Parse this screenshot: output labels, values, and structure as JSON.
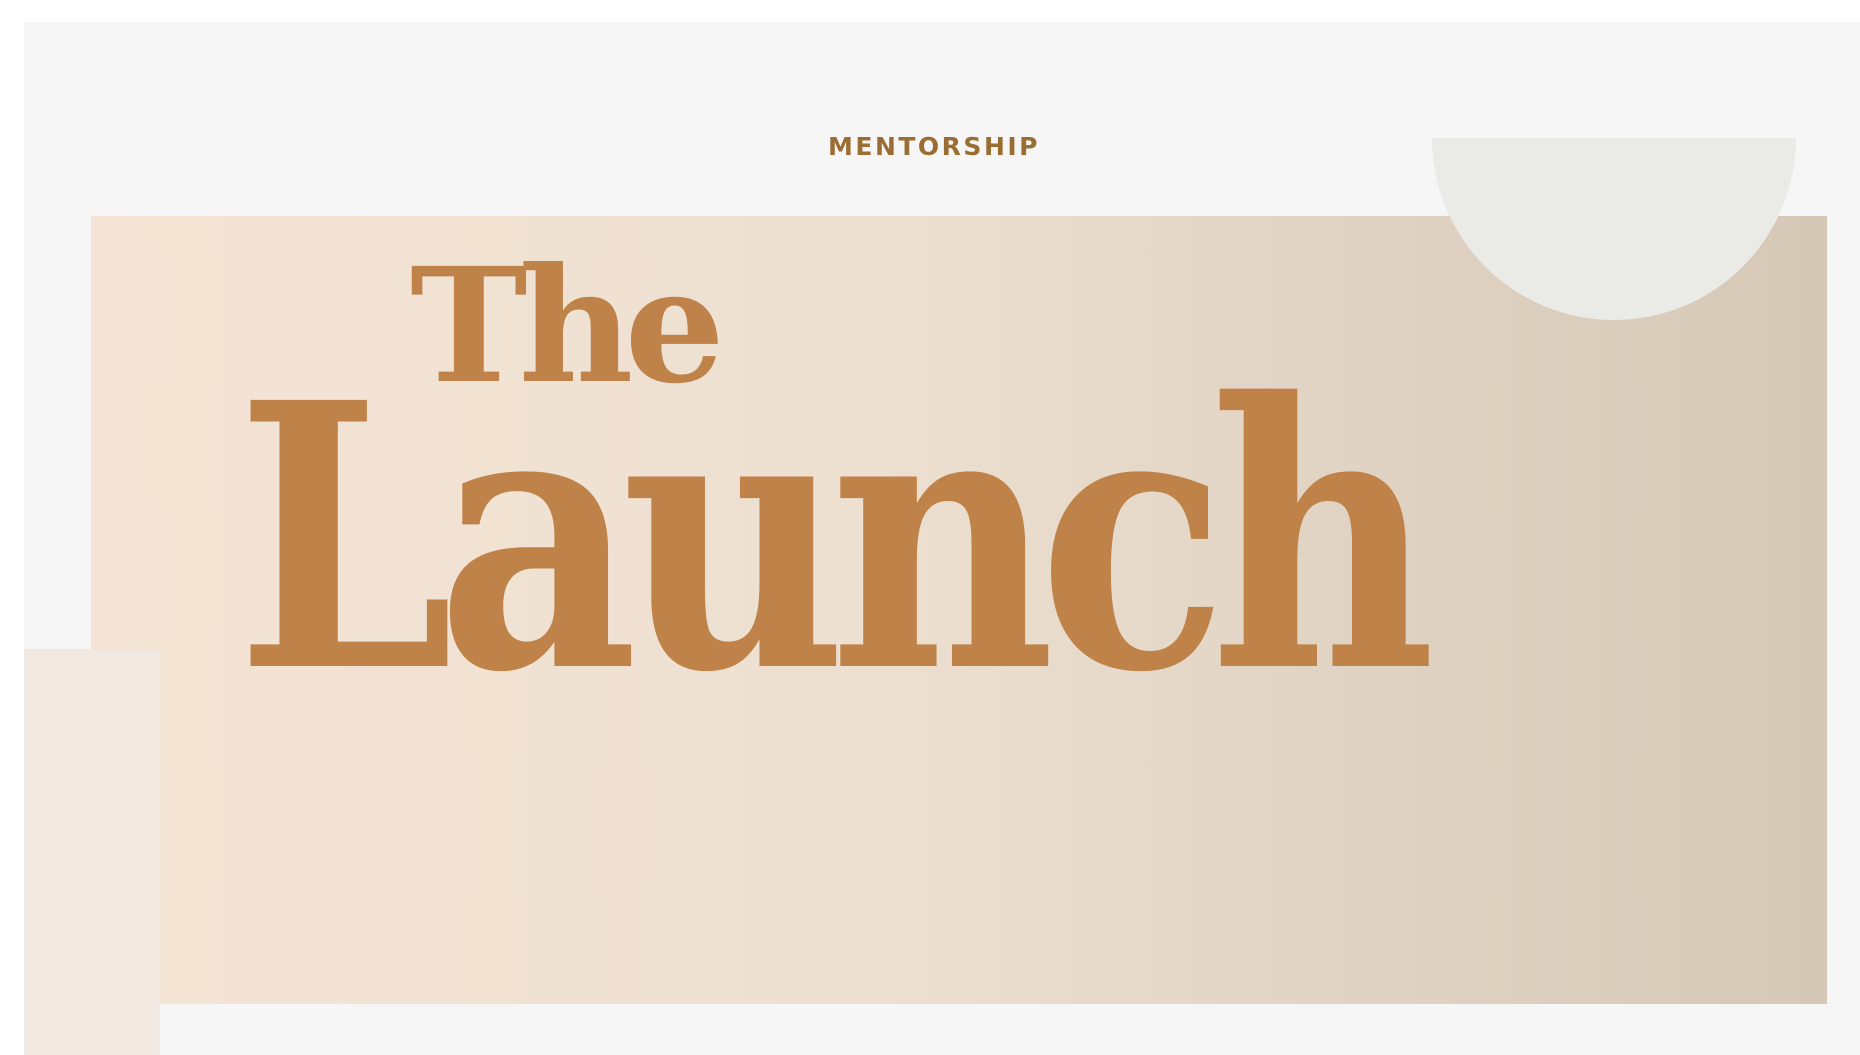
{
  "hero": {
    "eyebrow": "MENTORSHIP",
    "title_small": "The",
    "title_large": "Launch"
  },
  "colors": {
    "accent": "#bf8248",
    "eyebrow": "#9a6d33",
    "background": "#f6f6f6",
    "band_start": "#f5e4d5",
    "band_end": "#d6c8b6",
    "semicircle": "#eaebe7",
    "side_panel": "#f1e8e1"
  }
}
